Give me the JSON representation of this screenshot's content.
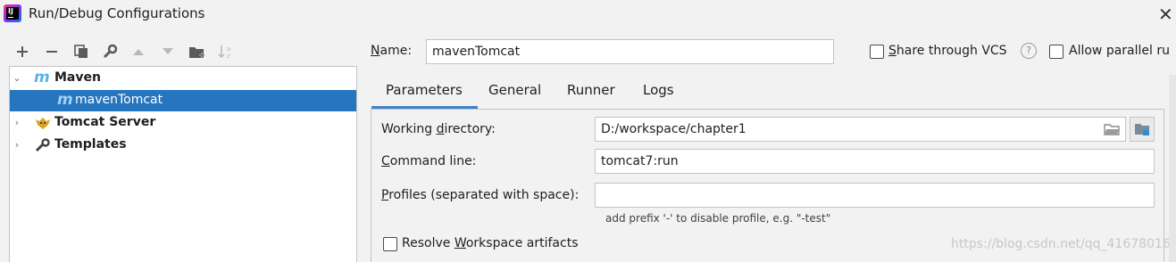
{
  "window": {
    "title": "Run/Debug Configurations",
    "close_glyph": "✕"
  },
  "toolbar": {
    "icons": [
      "add-icon",
      "remove-icon",
      "copy-icon",
      "wrench-icon",
      "move-up-icon",
      "move-down-icon",
      "new-folder-icon",
      "sort-icon"
    ]
  },
  "tree": {
    "items": [
      {
        "label": "Maven",
        "icon": "maven-icon",
        "expanded": true
      },
      {
        "label": "mavenTomcat",
        "icon": "maven-icon",
        "selected": true
      },
      {
        "label": "Tomcat Server",
        "icon": "tomcat-icon",
        "expanded": false
      },
      {
        "label": "Templates",
        "icon": "wrench-icon",
        "expanded": false
      }
    ]
  },
  "form": {
    "name_label": "Name:",
    "name_value": "mavenTomcat",
    "share_label": "Share through VCS",
    "share_checked": false,
    "parallel_label": "Allow parallel ru",
    "parallel_checked": false,
    "help_glyph": "?"
  },
  "tabs": [
    {
      "label": "Parameters",
      "active": true
    },
    {
      "label": "General"
    },
    {
      "label": "Runner"
    },
    {
      "label": "Logs"
    }
  ],
  "parameters": {
    "working_dir_label": "Working directory:",
    "working_dir_value": "D:/workspace/chapter1",
    "command_line_label": "Command line:",
    "command_line_value": "tomcat7:run",
    "profiles_label": "Profiles (separated with space):",
    "profiles_value": "",
    "profiles_hint": "add prefix '-' to disable profile, e.g. \"-test\"",
    "resolve_label": "Resolve Workspace artifacts",
    "resolve_checked": false
  },
  "watermark": "https://blog.csdn.net/qq_41678016",
  "colors": {
    "selection": "#2675bf",
    "accent": "#4083c9",
    "maven": "#5ab2e8"
  }
}
